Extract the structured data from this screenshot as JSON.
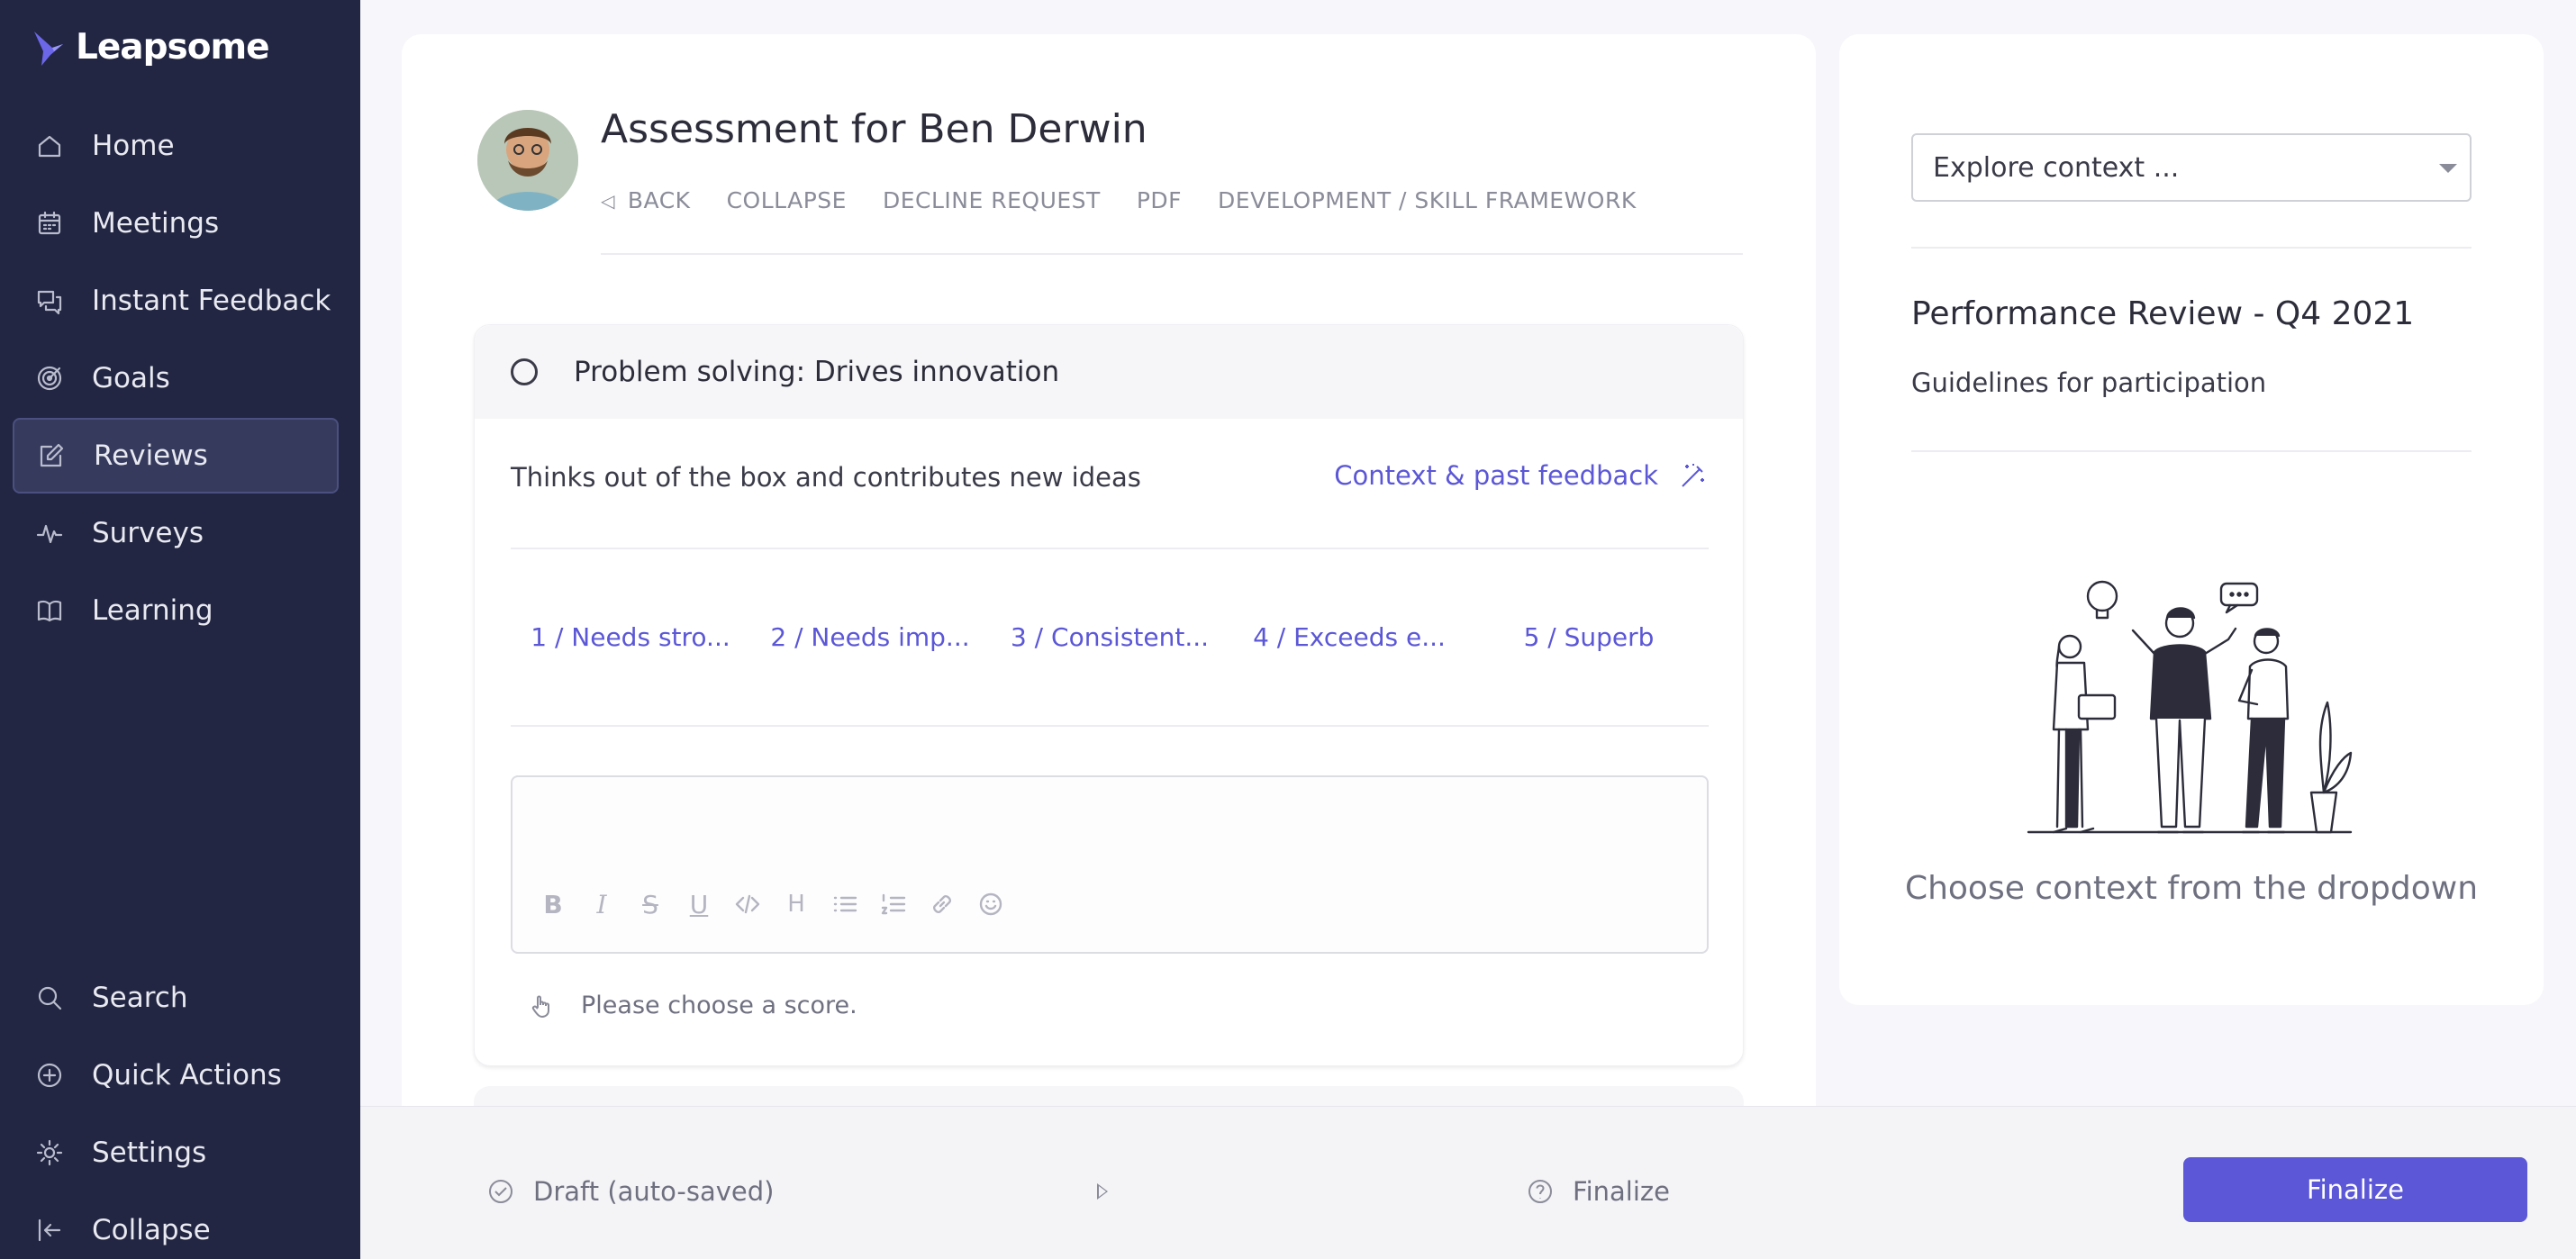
{
  "brand": {
    "name": "Leapsome",
    "accent": "#5b57d6",
    "sidebar_bg": "#222642"
  },
  "sidebar": {
    "items": [
      {
        "label": "Home",
        "icon": "home-icon"
      },
      {
        "label": "Meetings",
        "icon": "calendar-icon"
      },
      {
        "label": "Instant Feedback",
        "icon": "chat-icon"
      },
      {
        "label": "Goals",
        "icon": "target-icon"
      },
      {
        "label": "Reviews",
        "icon": "edit-icon",
        "active": true
      },
      {
        "label": "Surveys",
        "icon": "pulse-icon"
      },
      {
        "label": "Learning",
        "icon": "book-icon"
      }
    ],
    "bottom_items": [
      {
        "label": "Search",
        "icon": "search-icon"
      },
      {
        "label": "Quick Actions",
        "icon": "plus-circle-icon"
      },
      {
        "label": "Settings",
        "icon": "gear-icon"
      },
      {
        "label": "Collapse",
        "icon": "collapse-icon"
      }
    ]
  },
  "assessment": {
    "title": "Assessment for Ben Derwin",
    "actions": [
      "BACK",
      "COLLAPSE",
      "DECLINE REQUEST",
      "PDF",
      "DEVELOPMENT / SKILL FRAMEWORK"
    ]
  },
  "question": {
    "title": "Problem solving: Drives innovation",
    "description": "Thinks out of the box and contributes new ideas",
    "context_link": "Context & past feedback",
    "scores": [
      "1 / Needs stro...",
      "2 / Needs imp...",
      "3 / Consistent...",
      "4 / Exceeds e...",
      "5 / Superb"
    ],
    "editor_toolbar": [
      "bold-icon",
      "italic-icon",
      "strikethrough-icon",
      "underline-icon",
      "code-icon",
      "heading-icon",
      "bullet-list-icon",
      "numbered-list-icon",
      "link-icon",
      "emoji-icon"
    ],
    "hint": "Please choose a score."
  },
  "context_panel": {
    "select_placeholder": "Explore context ...",
    "cycle_title": "Performance Review - Q4 2021",
    "guidelines": "Guidelines for participation",
    "empty_text": "Choose context from the dropdown"
  },
  "footer": {
    "draft": "Draft (auto-saved)",
    "finalize_step": "Finalize",
    "finalize_button": "Finalize"
  }
}
